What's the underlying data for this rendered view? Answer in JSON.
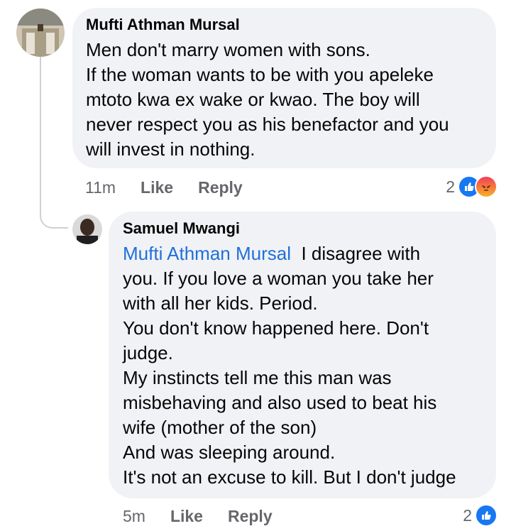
{
  "comment1": {
    "author": "Mufti Athman Mursal",
    "lines": [
      "Men don't marry women with sons.",
      "If the woman wants to be with you apeleke",
      "mtoto kwa ex wake or kwao. The boy will",
      "never respect you as his benefactor and you",
      "will invest in nothing."
    ],
    "time": "11m",
    "like_label": "Like",
    "reply_label": "Reply",
    "reaction_count": "2",
    "reactions": [
      "like-icon",
      "angry-icon"
    ]
  },
  "comment2": {
    "author": "Samuel Mwangi",
    "mention": "Mufti Athman Mursal",
    "first_line_rest": "I disagree with",
    "lines": [
      "you. If you love a woman you take her",
      "with all her kids. Period.",
      "You don't know happened here. Don't",
      "judge.",
      "My instincts tell me this man was",
      "misbehaving and also used to beat his",
      "wife (mother of the son)",
      "And was sleeping around.",
      "It's not an excuse to kill. But I don't judge"
    ],
    "time": "5m",
    "like_label": "Like",
    "reply_label": "Reply",
    "reaction_count": "2",
    "reactions": [
      "like-icon"
    ]
  },
  "colors": {
    "bubble": "#f0f2f5",
    "mention": "#216fdb",
    "meta": "#65676b",
    "like": "#1877f2"
  }
}
